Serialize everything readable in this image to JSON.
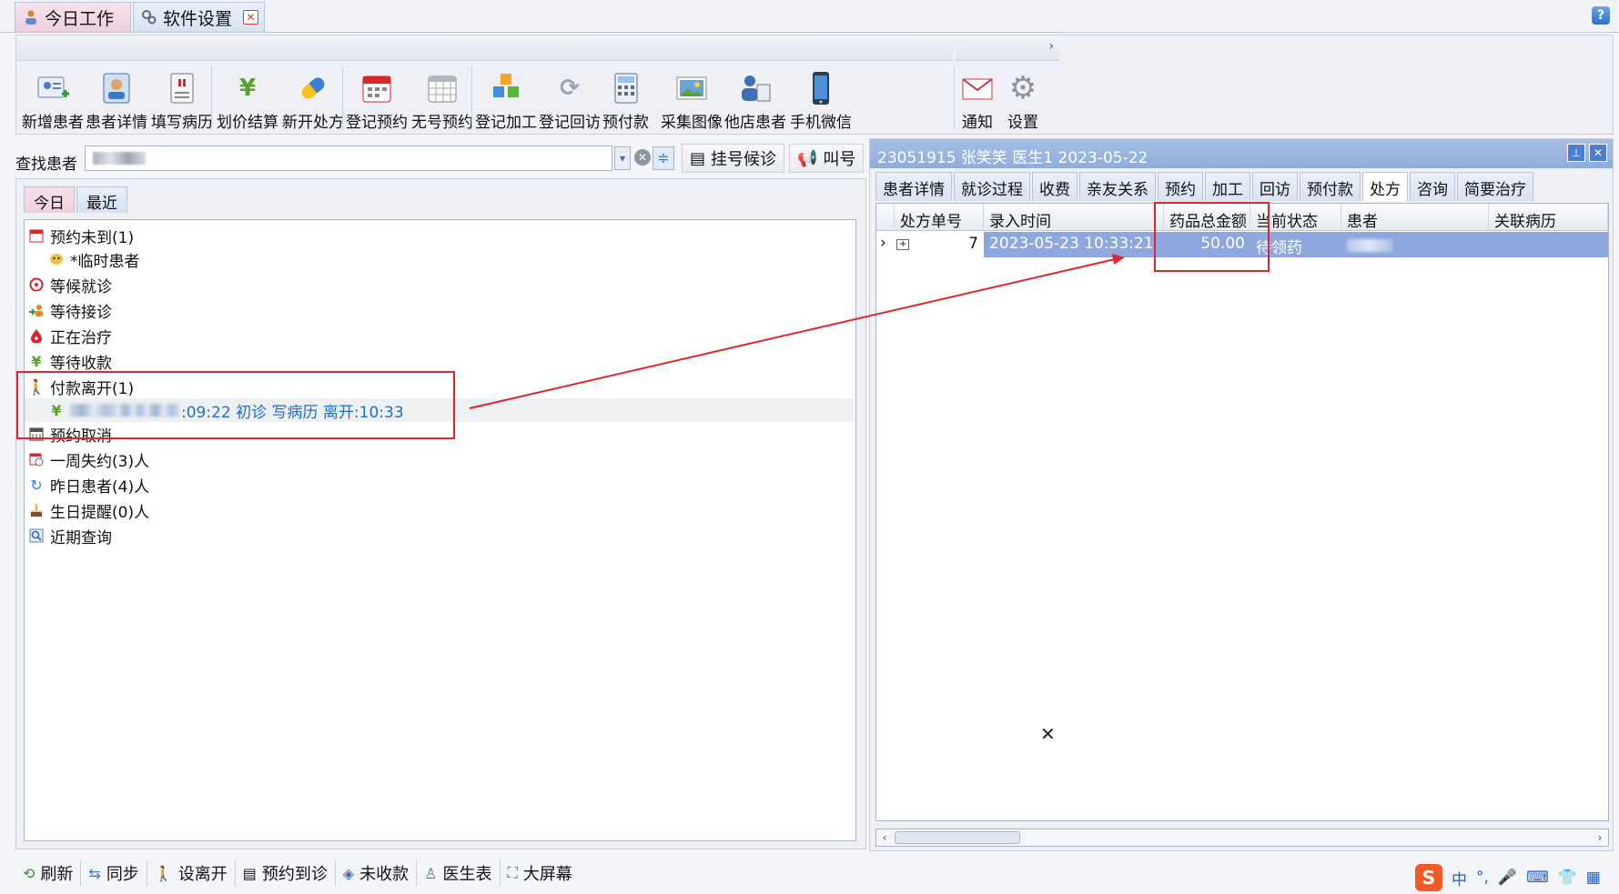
{
  "doc_tabs": [
    {
      "label": "今日工作"
    },
    {
      "label": "软件设置"
    }
  ],
  "help_label": "?",
  "ribbon": {
    "more_label": "›",
    "buttons": [
      {
        "label": "新增患者"
      },
      {
        "label": "患者详情"
      },
      {
        "label": "填写病历"
      },
      {
        "label": "划价结算"
      },
      {
        "label": "新开处方"
      },
      {
        "label": "登记预约"
      },
      {
        "label": "无号预约"
      },
      {
        "label": "登记加工"
      },
      {
        "label": "登记回访"
      },
      {
        "label": "预付款"
      },
      {
        "label": "采集图像"
      },
      {
        "label": "他店患者"
      },
      {
        "label": "手机微信"
      },
      {
        "label": "通知"
      },
      {
        "label": "设置"
      }
    ]
  },
  "search": {
    "label": "查找患者",
    "register_wait_label": "挂号候诊",
    "call_label": "叫号"
  },
  "left_tabs": [
    {
      "label": "今日"
    },
    {
      "label": "最近"
    }
  ],
  "tree": {
    "appointment_not_arrived": "预约未到(1)",
    "temp_patient": "*临时患者",
    "waiting_visit": "等候就诊",
    "waiting_reception": "等待接诊",
    "in_treatment": "正在治疗",
    "waiting_payment": "等待收款",
    "paid_left": "付款离开(1)",
    "paid_left_detail": ":09:22 初诊 写病历 离开:10:33",
    "appointment_cancelled": "预约取消",
    "week_missed": "一周失约(3)人",
    "yesterday_patients": "昨日患者(4)人",
    "birthday_reminder": "生日提醒(0)人",
    "recent_query": "近期查询"
  },
  "bottom_bar": [
    {
      "label": "刷新"
    },
    {
      "label": "同步"
    },
    {
      "label": "设离开"
    },
    {
      "label": "预约到诊"
    },
    {
      "label": "未收款"
    },
    {
      "label": "医生表"
    },
    {
      "label": "大屏幕"
    }
  ],
  "right_panel": {
    "title": "23051915 张笑笑 医生1 2023-05-22",
    "tabs": [
      {
        "label": "患者详情"
      },
      {
        "label": "就诊过程"
      },
      {
        "label": "收费"
      },
      {
        "label": "亲友关系"
      },
      {
        "label": "预约"
      },
      {
        "label": "加工"
      },
      {
        "label": "回访"
      },
      {
        "label": "预付款"
      },
      {
        "label": "处方",
        "active": true
      },
      {
        "label": "咨询"
      },
      {
        "label": "简要治疗"
      }
    ],
    "columns": [
      "处方单号",
      "录入时间",
      "药品总金额",
      "当前状态",
      "患者",
      "关联病历"
    ],
    "rows": [
      {
        "id": "7",
        "time": "2023-05-23 10:33:21",
        "amount": "50.00",
        "status": "待领药",
        "patient": "",
        "record": ""
      }
    ]
  },
  "ime": {
    "logo": "S",
    "lang": "中",
    "punct": "°,"
  },
  "colors": {
    "selected_row": "#8ea8df",
    "title_bar": "#9bb6e0",
    "annotation_red": "#e0242c",
    "link_blue": "#1b6fcf"
  }
}
